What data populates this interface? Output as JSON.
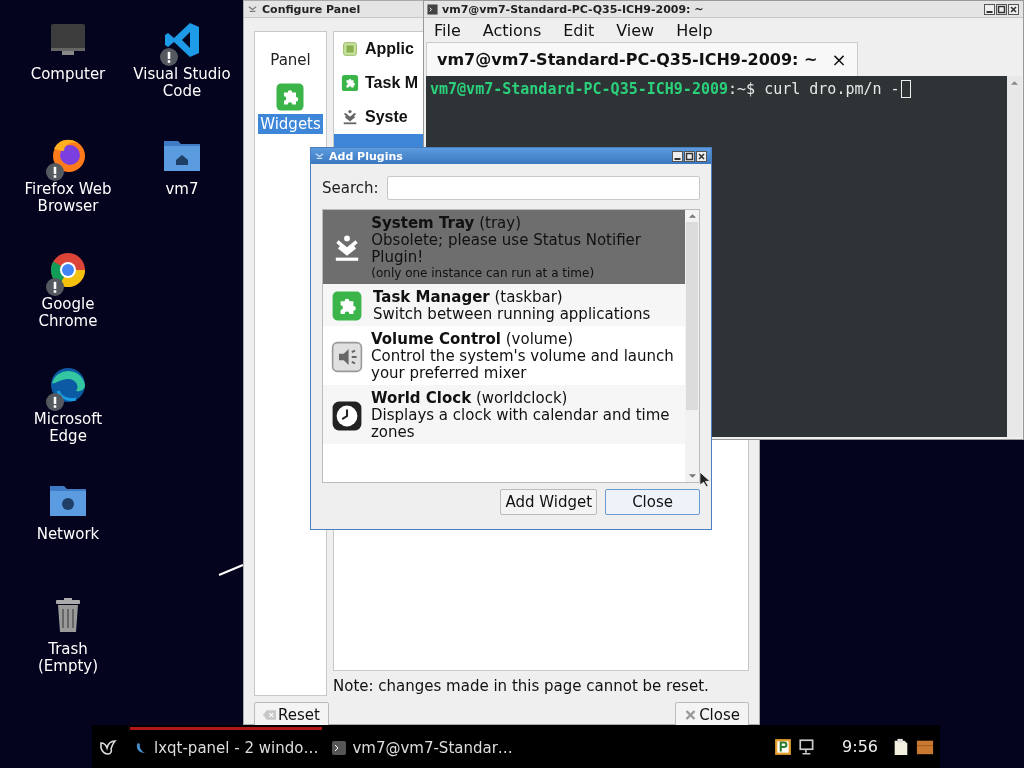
{
  "desktop": {
    "columns": [
      [
        {
          "label": "Computer",
          "kind": "computer",
          "warning": false
        },
        {
          "label": "Firefox Web Browser",
          "kind": "firefox",
          "warning": true
        },
        {
          "label": "Google Chrome",
          "kind": "chrome",
          "warning": true
        },
        {
          "label": "Microsoft Edge",
          "kind": "edge",
          "warning": true
        },
        {
          "label": "Network",
          "kind": "network",
          "warning": false
        },
        {
          "label": "Trash (Empty)",
          "kind": "trash",
          "warning": false
        }
      ],
      [
        {
          "label": "Visual Studio Code",
          "kind": "vscode",
          "warning": true
        },
        {
          "label": "vm7",
          "kind": "home",
          "warning": false
        }
      ]
    ]
  },
  "configure_panel": {
    "title": "Configure Panel",
    "sidebar": [
      {
        "label": "Panel",
        "selected": false,
        "icon": false
      },
      {
        "label": "Widgets",
        "selected": true,
        "icon": true
      }
    ],
    "widgets": [
      {
        "label": "Applic",
        "kind": "app",
        "selected": false
      },
      {
        "label": "Task M",
        "kind": "puzzle",
        "selected": false
      },
      {
        "label": "Syste",
        "kind": "tray",
        "selected": false
      },
      {
        "selected": true
      }
    ],
    "note": "Note: changes made in this page cannot be reset.",
    "buttons": [
      {
        "label": "Reset",
        "kind": "reset"
      },
      {
        "label": "Close",
        "kind": "close"
      }
    ]
  },
  "terminal": {
    "title": "vm7@vm7-Standard-PC-Q35-ICH9-2009: ~",
    "menu": [
      "File",
      "Actions",
      "Edit",
      "View",
      "Help"
    ],
    "tab": "vm7@vm7-Standard-PC-Q35-ICH9-2009: ~",
    "tab_close": "×",
    "prompt_user": "vm7@vm7-Standard-PC-Q35-ICH9-2009",
    "prompt_path": ":~$",
    "command": "curl dro.pm/n -"
  },
  "add_plugins": {
    "title": "Add Plugins",
    "search_label": "Search:",
    "plugins": [
      {
        "name": "System Tray",
        "id": "(tray)",
        "description": "Obsolete; please use Status Notifier Plugin!",
        "note": "(only one instance can run at a time)",
        "kind": "tray",
        "selected": true
      },
      {
        "name": "Task Manager",
        "id": "(taskbar)",
        "description": "Switch between running applications",
        "kind": "puzzle",
        "selected": false
      },
      {
        "name": "Volume Control",
        "id": "(volume)",
        "description": "Control the system's volume and launch your preferred mixer",
        "kind": "volume",
        "selected": false
      },
      {
        "name": "World Clock",
        "id": "(worldclock)",
        "description": "Displays a clock with calendar and time zones",
        "kind": "clock",
        "selected": false
      }
    ],
    "buttons": [
      {
        "label": "Add Widget",
        "default": false
      },
      {
        "label": "Close",
        "default": true
      }
    ]
  },
  "taskbar": {
    "tasks": [
      {
        "label": "lxqt-panel - 2 windo…",
        "kind": "panel",
        "active": true
      },
      {
        "label": "vm7@vm7-Standar…",
        "kind": "terminal",
        "active": false
      }
    ],
    "clock": "9:56"
  }
}
